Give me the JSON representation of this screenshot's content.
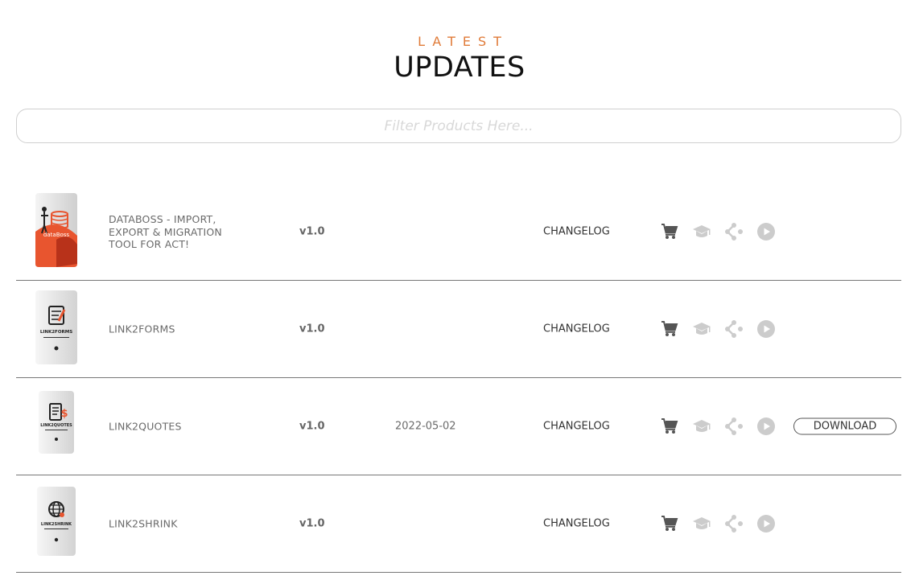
{
  "header": {
    "eyebrow": "LATEST",
    "title": "UPDATES"
  },
  "filter": {
    "placeholder": "Filter Products Here...",
    "value": ""
  },
  "colors": {
    "accent": "#e07b39",
    "box_red": "#e8552f",
    "icon_dark": "#555555",
    "icon_light": "#cccccc"
  },
  "products": [
    {
      "name": "DATABOSS - IMPORT, EXPORT & MIGRATION TOOL FOR ACT!",
      "version": "v1.0",
      "date": "",
      "changelog": "CHANGELOG",
      "download": "",
      "box_icon": "database-icon",
      "box_label": "dataBoss"
    },
    {
      "name": "LINK2FORMS",
      "version": "v1.0",
      "date": "",
      "changelog": "CHANGELOG",
      "download": "",
      "box_icon": "form-icon",
      "box_label": "LINK2FORMS"
    },
    {
      "name": "LINK2QUOTES",
      "version": "v1.0",
      "date": "2022-05-02",
      "changelog": "CHANGELOG",
      "download": "DOWNLOAD",
      "box_icon": "quote-icon",
      "box_label": "LINK2QUOTES"
    },
    {
      "name": "LINK2SHRINK",
      "version": "v1.0",
      "date": "",
      "changelog": "CHANGELOG",
      "download": "",
      "box_icon": "globe-icon",
      "box_label": "LINK2SHRINK"
    }
  ],
  "action_icons": [
    "cart-icon",
    "graduation-cap-icon",
    "share-icon",
    "play-icon"
  ]
}
